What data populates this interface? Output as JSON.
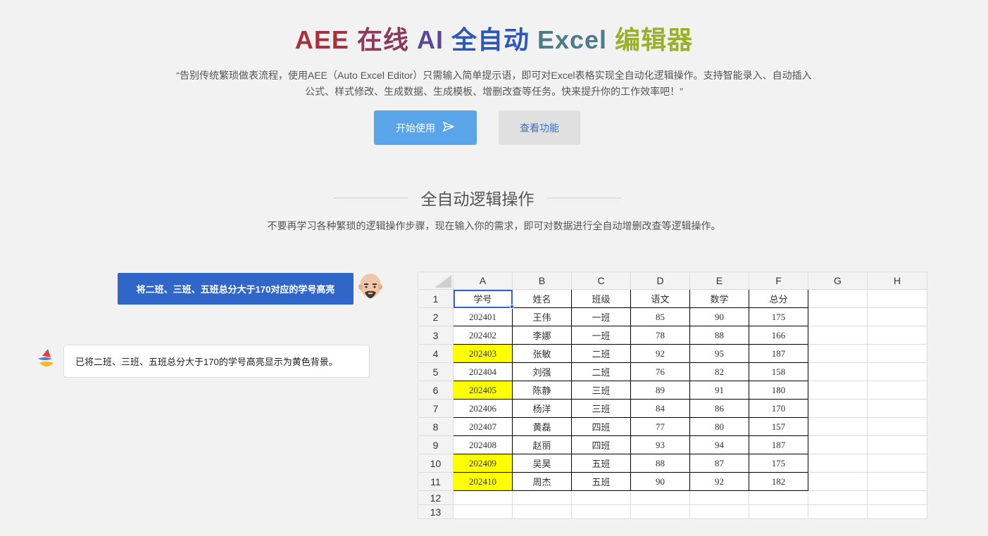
{
  "hero": {
    "title_parts": [
      {
        "text": "AEE",
        "color": "#a8323c"
      },
      {
        "text": "在线",
        "color": "#8b3a5c"
      },
      {
        "text": "AI",
        "color": "#5b4796"
      },
      {
        "text": "全自动",
        "color": "#2f57b8"
      },
      {
        "text": "Excel",
        "color": "#4f7a8a"
      },
      {
        "text": "编辑器",
        "color": "#9bb02a"
      }
    ],
    "description": "“告别传统繁琐做表流程，使用AEE（Auto Excel Editor）只需输入简单提示语，即可对Excel表格实现全自动化逻辑操作。支持智能录入、自动插入公式、样式修改、生成数据、生成模板、增删改查等任务。快来提升你的工作效率吧！”",
    "start_button": "开始使用",
    "features_button": "查看功能"
  },
  "section": {
    "title": "全自动逻辑操作",
    "subtitle": "不要再学习各种繁琐的逻辑操作步骤，现在输入你的需求，即可对数据进行全自动增删改查等逻辑操作。"
  },
  "chat": {
    "user_message": "将二班、三班、五班总分大于170对应的学号高亮",
    "bot_message": "已将二班、三班、五班总分大于170的学号高亮显示为黄色背景。"
  },
  "sheet": {
    "columns": [
      "A",
      "B",
      "C",
      "D",
      "E",
      "F",
      "G",
      "H"
    ],
    "header_row": [
      "学号",
      "姓名",
      "班级",
      "语文",
      "数学",
      "总分"
    ],
    "rows": [
      {
        "id": "202401",
        "name": "王伟",
        "class": "一班",
        "chinese": "85",
        "math": "90",
        "total": "175",
        "highlight": false
      },
      {
        "id": "202402",
        "name": "李娜",
        "class": "一班",
        "chinese": "78",
        "math": "88",
        "total": "166",
        "highlight": false
      },
      {
        "id": "202403",
        "name": "张敏",
        "class": "二班",
        "chinese": "92",
        "math": "95",
        "total": "187",
        "highlight": true
      },
      {
        "id": "202404",
        "name": "刘强",
        "class": "二班",
        "chinese": "76",
        "math": "82",
        "total": "158",
        "highlight": false
      },
      {
        "id": "202405",
        "name": "陈静",
        "class": "三班",
        "chinese": "89",
        "math": "91",
        "total": "180",
        "highlight": true
      },
      {
        "id": "202406",
        "name": "杨洋",
        "class": "三班",
        "chinese": "84",
        "math": "86",
        "total": "170",
        "highlight": false
      },
      {
        "id": "202407",
        "name": "黄磊",
        "class": "四班",
        "chinese": "77",
        "math": "80",
        "total": "157",
        "highlight": false
      },
      {
        "id": "202408",
        "name": "赵丽",
        "class": "四班",
        "chinese": "93",
        "math": "94",
        "total": "187",
        "highlight": false
      },
      {
        "id": "202409",
        "name": "吴昊",
        "class": "五班",
        "chinese": "88",
        "math": "87",
        "total": "175",
        "highlight": true
      },
      {
        "id": "202410",
        "name": "周杰",
        "class": "五班",
        "chinese": "90",
        "math": "92",
        "total": "182",
        "highlight": true
      }
    ],
    "row_numbers": [
      "1",
      "2",
      "3",
      "4",
      "5",
      "6",
      "7",
      "8",
      "9",
      "10",
      "11",
      "12",
      "13"
    ],
    "highlight_color": "#ffff00"
  },
  "icons": {
    "start": "send-icon",
    "user_avatar": "bald-man-avatar",
    "bot_avatar": "bird-logo-icon"
  }
}
